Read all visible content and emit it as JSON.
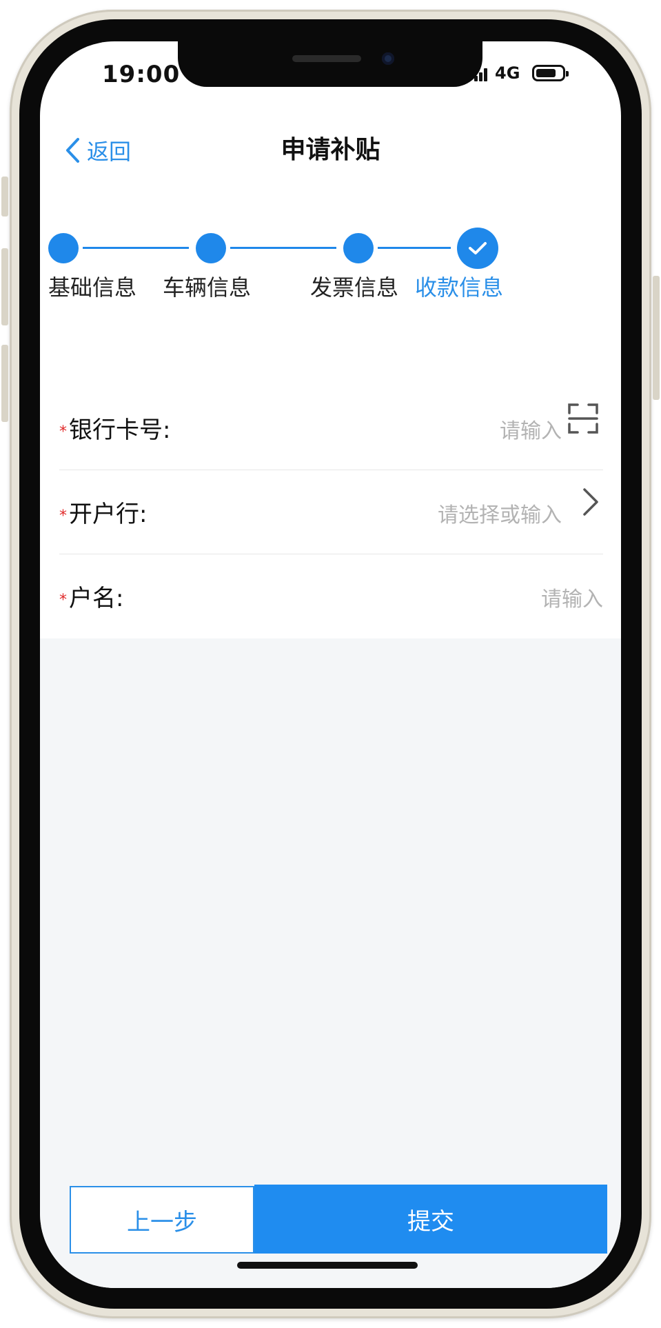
{
  "status_bar": {
    "time": "19:00",
    "network": "4G"
  },
  "nav": {
    "back_label": "返回",
    "title": "申请补贴"
  },
  "steps": [
    {
      "label": "基础信息",
      "done": true
    },
    {
      "label": "车辆信息",
      "done": true
    },
    {
      "label": "发票信息",
      "done": true
    },
    {
      "label": "收款信息",
      "done": true,
      "active": true
    }
  ],
  "form": {
    "required_mark": "*",
    "fields": [
      {
        "label": "银行卡号:",
        "placeholder": "请输入",
        "icon": "scan-icon"
      },
      {
        "label": "开户行:",
        "placeholder": "请选择或输入",
        "icon": "chevron-right-icon"
      },
      {
        "label": "户名:",
        "placeholder": "请输入"
      }
    ]
  },
  "actions": {
    "prev_label": "上一步",
    "submit_label": "提交"
  },
  "colors": {
    "accent": "#1f88ea",
    "required": "#e02a2a",
    "placeholder": "#b3b3b3"
  }
}
